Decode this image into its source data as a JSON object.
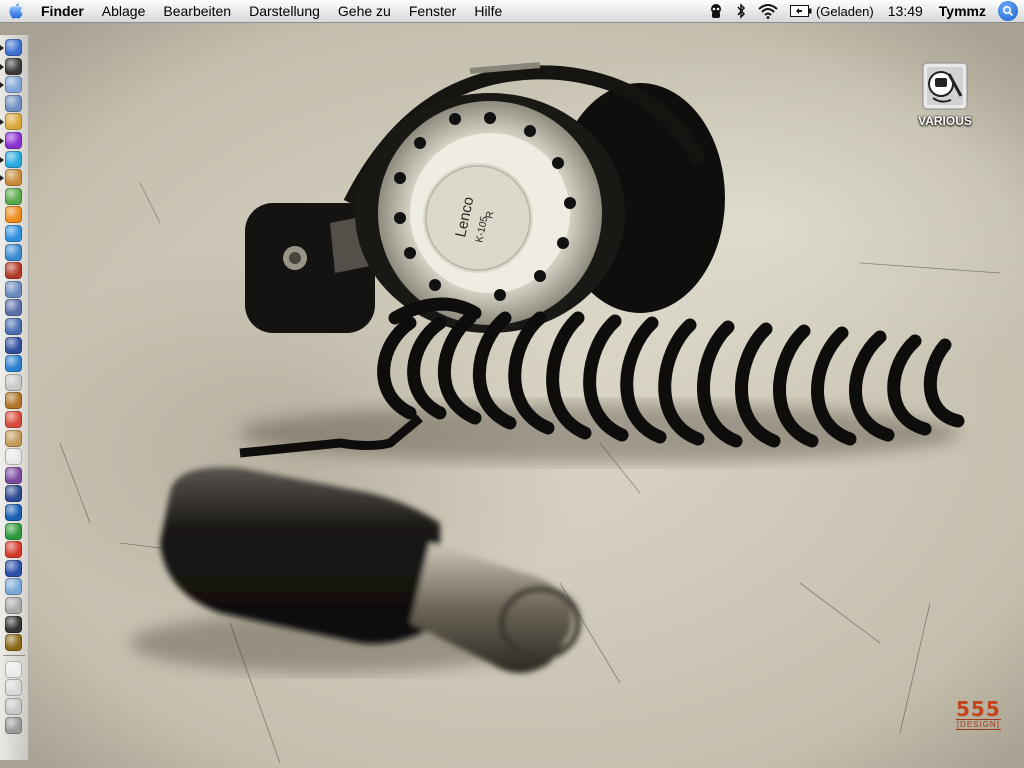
{
  "menubar": {
    "app": "Finder",
    "items": [
      "Ablage",
      "Bearbeiten",
      "Darstellung",
      "Gehe zu",
      "Fenster",
      "Hilfe"
    ],
    "status": {
      "battery_text": "(Geladen)",
      "clock": "13:49",
      "user": "Tymmz",
      "icons": [
        "status-menu-icon",
        "bluetooth-icon",
        "wifi-icon",
        "battery-icon",
        "spotlight-icon"
      ]
    }
  },
  "desktop": {
    "items": [
      {
        "label": "VARIOUS",
        "icon": "disk-image-icon"
      }
    ],
    "wallpaper_brand": {
      "number": "555",
      "tag": "[DESIGN]"
    },
    "wallpaper_text": {
      "brand": "Lenco",
      "model": "K-105",
      "side": "R"
    }
  },
  "dock": {
    "items": [
      {
        "name": "finder",
        "color": "#3d6fd0",
        "running": true
      },
      {
        "name": "dashboard",
        "color": "#3a3a3a",
        "running": true
      },
      {
        "name": "mail",
        "color": "#7fa6d8",
        "running": true
      },
      {
        "name": "address-book",
        "color": "#6f8fc0",
        "running": false
      },
      {
        "name": "ical",
        "color": "#d9a83a",
        "running": true
      },
      {
        "name": "itunes",
        "color": "#8a2fd0",
        "running": true
      },
      {
        "name": "skype",
        "color": "#28a9e0",
        "running": true
      },
      {
        "name": "automator",
        "color": "#c98a3a",
        "running": true
      },
      {
        "name": "utility",
        "color": "#59a84a",
        "running": false
      },
      {
        "name": "vlc",
        "color": "#f08a1c",
        "running": false
      },
      {
        "name": "safari",
        "color": "#2d8fe0",
        "running": false
      },
      {
        "name": "system-preferences",
        "color": "#3a8ad0",
        "running": false
      },
      {
        "name": "photo-booth",
        "color": "#b23a2a",
        "running": false
      },
      {
        "name": "iphoto",
        "color": "#6a8abf",
        "running": false
      },
      {
        "name": "imovie",
        "color": "#5b6fa8",
        "running": false
      },
      {
        "name": "preview",
        "color": "#4a6fb0",
        "running": false
      },
      {
        "name": "quicktime",
        "color": "#2f4f9f",
        "running": false
      },
      {
        "name": "globe",
        "color": "#2a7fd0",
        "running": false
      },
      {
        "name": "garageband",
        "color": "#c9c9c9",
        "running": false
      },
      {
        "name": "guitar",
        "color": "#b0742a",
        "running": false
      },
      {
        "name": "calendar",
        "color": "#d84a3a",
        "running": false
      },
      {
        "name": "notebook",
        "color": "#c39a5a",
        "running": false
      },
      {
        "name": "textedit",
        "color": "#e8e8e8",
        "running": false
      },
      {
        "name": "paint",
        "color": "#7a4aa0",
        "running": false
      },
      {
        "name": "terminal-app",
        "color": "#2c4a8f",
        "running": false
      },
      {
        "name": "dreamweaver",
        "color": "#1a5fb4",
        "running": false
      },
      {
        "name": "excel",
        "color": "#2e9a3a",
        "running": false
      },
      {
        "name": "tool",
        "color": "#d43a2a",
        "running": false
      },
      {
        "name": "plane",
        "color": "#2a4fa8",
        "running": false
      },
      {
        "name": "globe-2",
        "color": "#7aa8d8",
        "running": false
      },
      {
        "name": "airport",
        "color": "#aaaaaa",
        "running": false
      },
      {
        "name": "terminal",
        "color": "#333333",
        "running": false
      },
      {
        "name": "world-of-warcraft",
        "color": "#8a6a1a",
        "running": false
      },
      {
        "name": "documents-stack",
        "color": "#eaeaea",
        "running": false
      },
      {
        "name": "downloads-stack",
        "color": "#d8d8d8",
        "running": false
      },
      {
        "name": "applications-stack",
        "color": "#c8c8c8",
        "running": false
      },
      {
        "name": "trash",
        "color": "#9a9a9a",
        "running": false
      }
    ]
  }
}
